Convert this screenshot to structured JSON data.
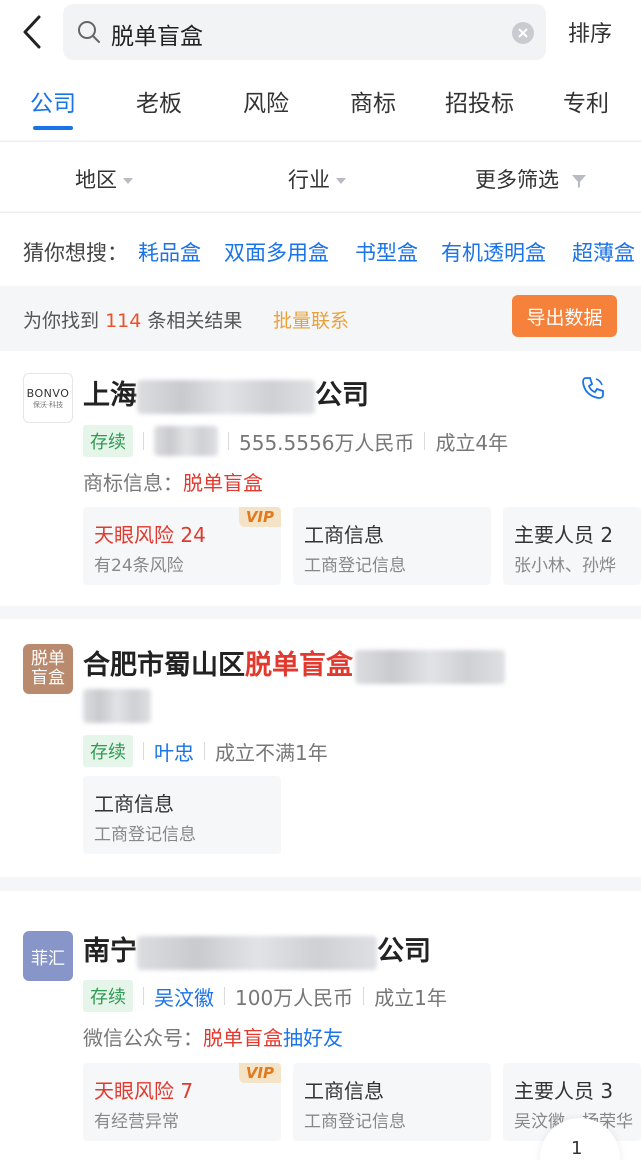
{
  "header": {
    "search_query": "脱单盲盒",
    "sort_label": "排序"
  },
  "tabs": [
    {
      "label": "公司",
      "active": true
    },
    {
      "label": "老板",
      "active": false
    },
    {
      "label": "风险",
      "active": false
    },
    {
      "label": "商标",
      "active": false
    },
    {
      "label": "招投标",
      "active": false
    },
    {
      "label": "专利",
      "active": false
    }
  ],
  "filters": [
    {
      "label": "地区"
    },
    {
      "label": "行业"
    },
    {
      "label": "更多筛选"
    }
  ],
  "guess": {
    "label": "猜你想搜：",
    "keywords": [
      "耗品盒",
      "双面多用盒",
      "书型盒",
      "有机透明盒",
      "超薄盒"
    ]
  },
  "summary": {
    "prefix": "为你找到",
    "count": "114",
    "suffix": "条相关结果",
    "bulk_contact": "批量联系",
    "export_label": "导出数据"
  },
  "colors": {
    "accent_blue": "#1a73e8",
    "highlight_red": "#e2392e",
    "export_orange": "#f5813a",
    "status_green": "#2f9a52"
  },
  "results": [
    {
      "logo_text": "BONVO",
      "logo_sub": "保沃·科技",
      "name_start": "上海",
      "name_end": "公司",
      "status": "存续",
      "capital": "555.5556万人民币",
      "established": "成立4年",
      "info_label": "商标信息：",
      "info_value": "脱单盲盒",
      "boxes": [
        {
          "title": "天眼风险 24",
          "sub": "有24条风险",
          "vip": "VIP"
        },
        {
          "title": "工商信息",
          "sub": "工商登记信息"
        },
        {
          "title": "主要人员 2",
          "sub": "张小林、孙烨"
        }
      ]
    },
    {
      "logo_text": "脱单盲盒",
      "name_start": "合肥市蜀山区",
      "name_hl": "脱单盲盒",
      "status": "存续",
      "person": "叶忠",
      "established": "成立不满1年",
      "boxes": [
        {
          "title": "工商信息",
          "sub": "工商登记信息"
        }
      ]
    },
    {
      "logo_text": "菲汇",
      "name_start": "南宁",
      "name_end": "公司",
      "status": "存续",
      "person": "吴汶徽",
      "capital": "100万人民币",
      "established": "成立1年",
      "info_label": "微信公众号：",
      "info_value": "脱单盲盒",
      "info_value2": "抽好友",
      "boxes": [
        {
          "title": "天眼风险 7",
          "sub": "有经营异常",
          "vip": "VIP"
        },
        {
          "title": "工商信息",
          "sub": "工商登记信息"
        },
        {
          "title": "主要人员 3",
          "sub": "吴汶徽、杨荣华"
        }
      ]
    }
  ],
  "page_number": "1"
}
